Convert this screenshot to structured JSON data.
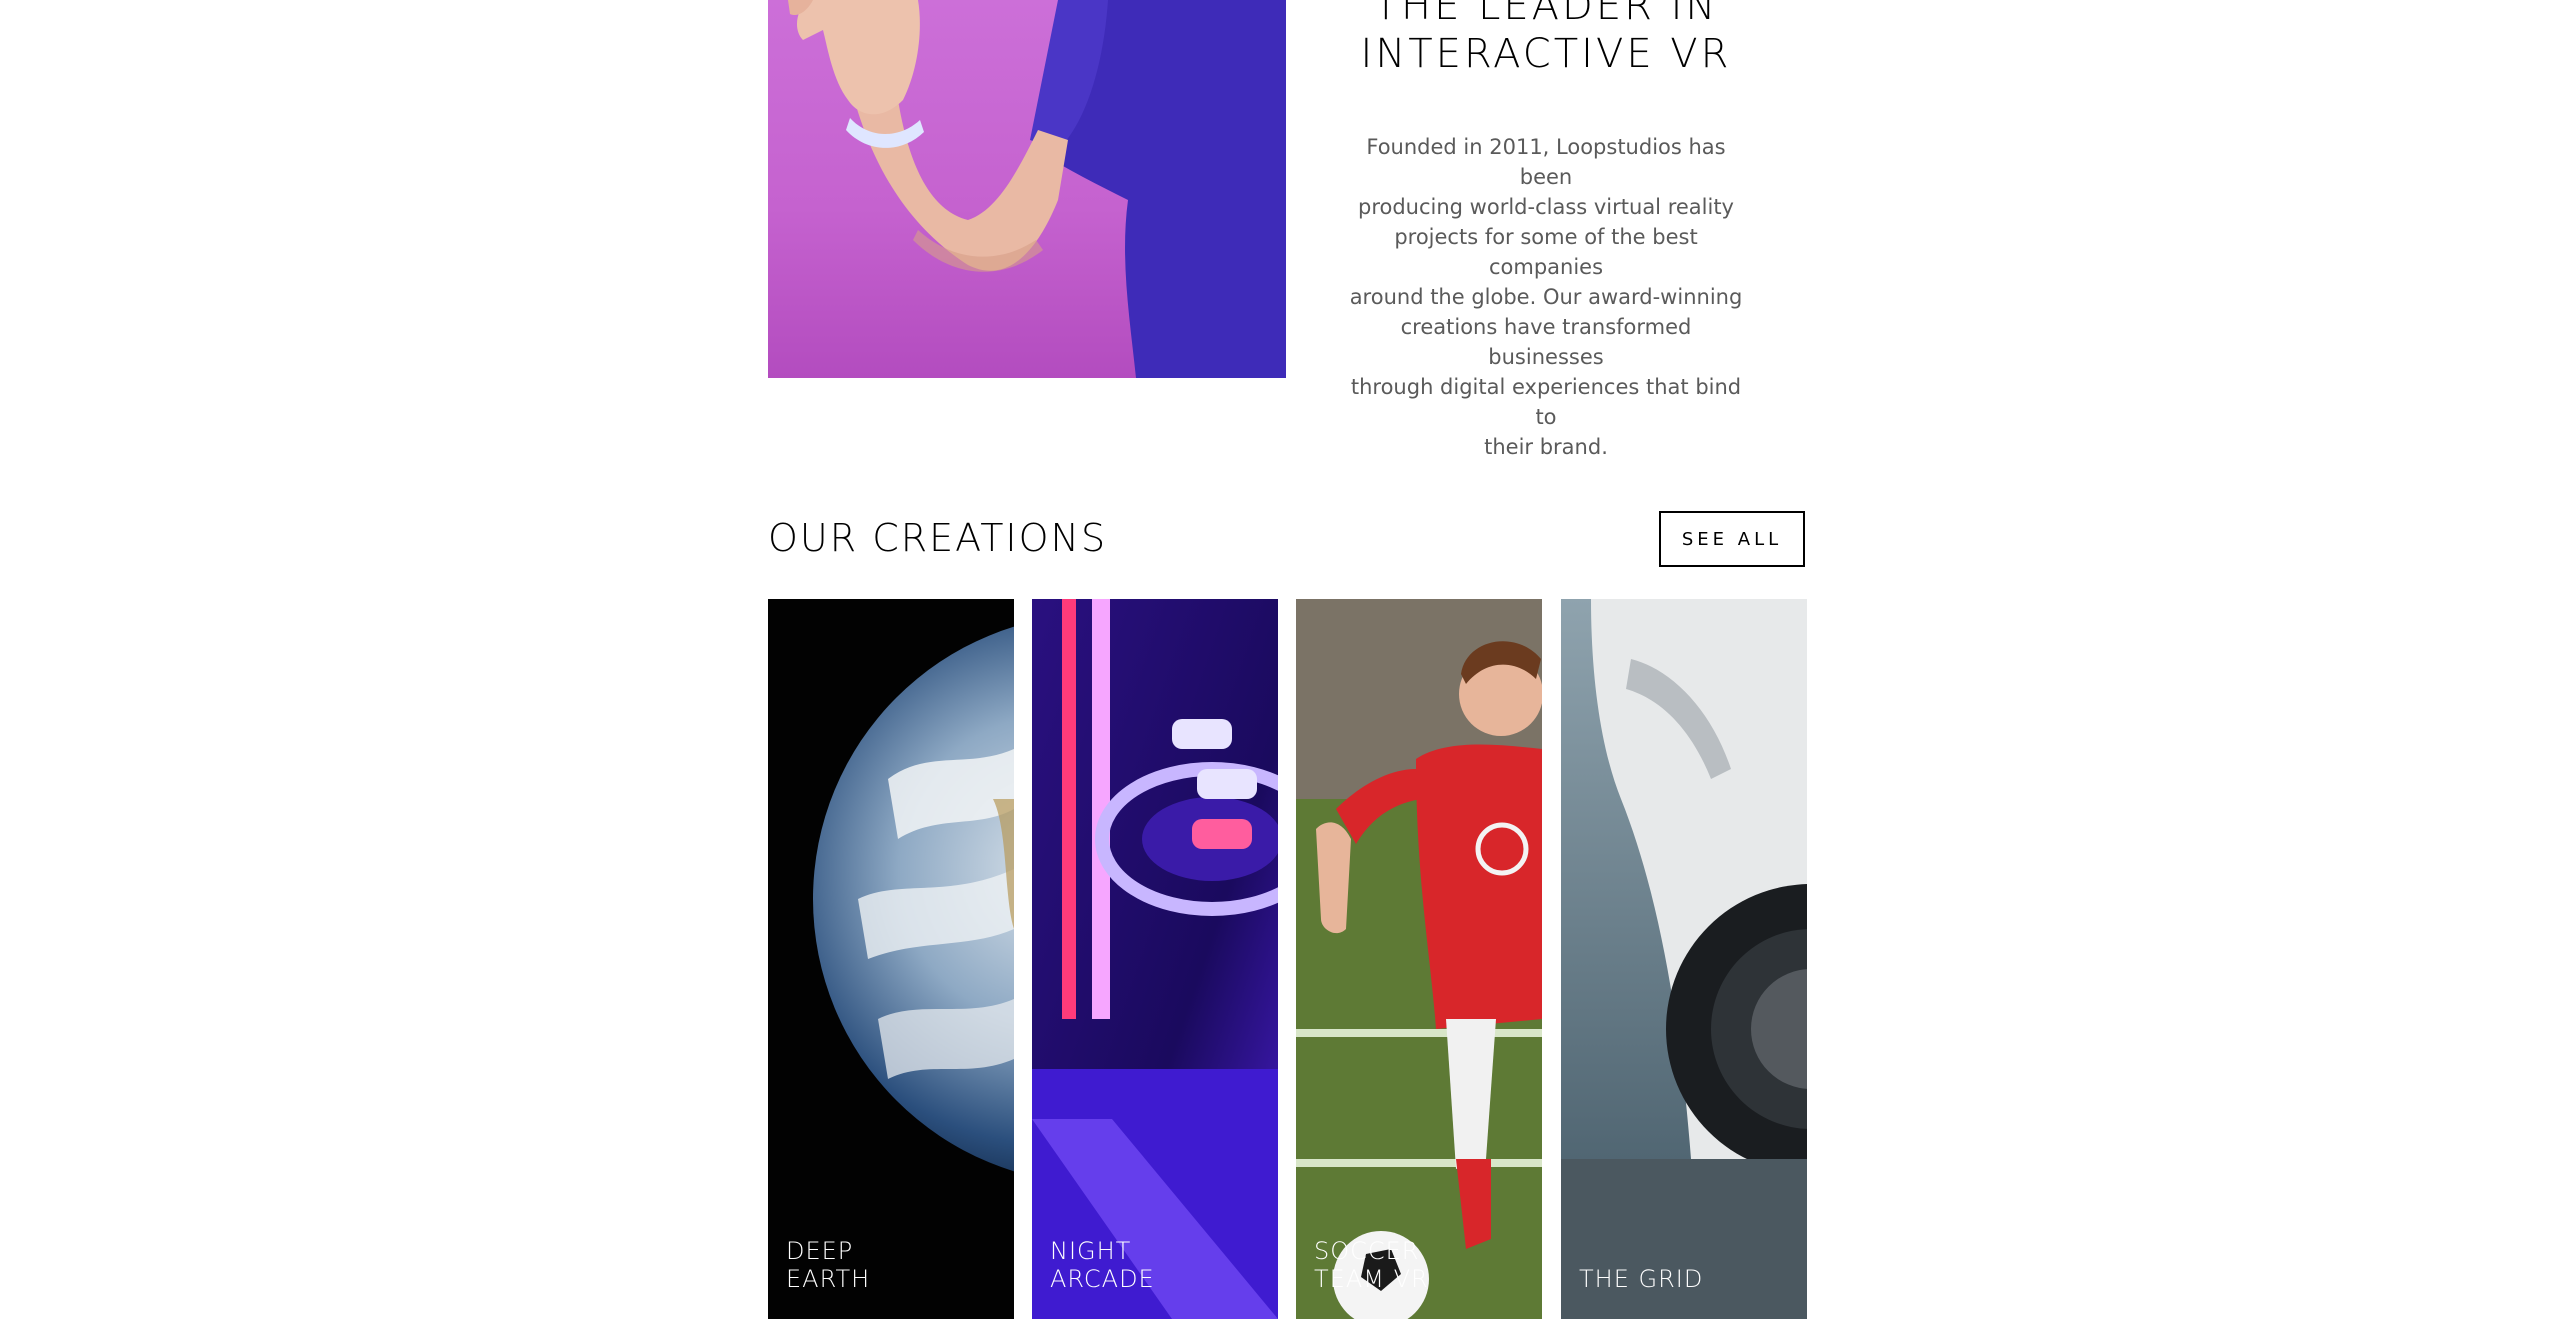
{
  "about": {
    "title_line1": "THE LEADER IN",
    "title_line2": "INTERACTIVE VR",
    "paragraph_lines": [
      "Founded in 2011, Loopstudios has been",
      "producing world-class virtual reality",
      "projects for some of the best companies",
      "around the globe. Our award-winning",
      "creations have transformed businesses",
      "through digital experiences that bind to",
      "their brand."
    ]
  },
  "creations": {
    "title": "OUR CREATIONS",
    "see_all_label": "SEE ALL",
    "cards": [
      {
        "line1": "DEEP",
        "line2": "EARTH"
      },
      {
        "line1": "NIGHT",
        "line2": "ARCADE"
      },
      {
        "line1": "SOCCER",
        "line2": "TEAM VR"
      },
      {
        "line1": "",
        "line2": "THE GRID"
      }
    ]
  },
  "colors": {
    "text": "#000000",
    "body_text": "#5a5a5a",
    "hero_bg": "#c562cf"
  }
}
